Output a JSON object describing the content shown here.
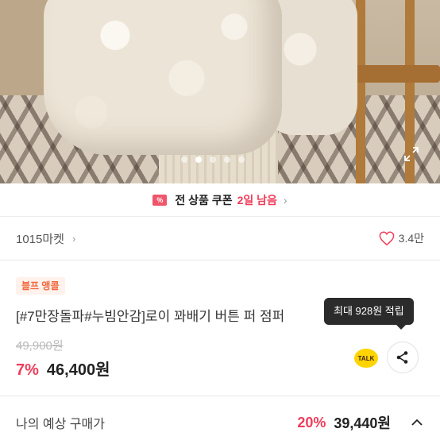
{
  "gallery": {
    "page_count": 5,
    "active_index": 1,
    "expand_icon": "expand-icon"
  },
  "coupon_banner": {
    "icon": "coupon-icon",
    "icon_text": "%",
    "text_prefix": "전 상품 쿠폰",
    "highlight": "2일 남음",
    "chevron": "›"
  },
  "seller": {
    "name": "1015마켓",
    "chevron": "›",
    "likes": "3.4만",
    "heart_color": "#ef3d5a"
  },
  "product": {
    "badge": "블프 앵콜",
    "title": "[#7만장돌파#누빔안감]로이 꽈배기 버튼 퍼 점퍼",
    "original_price": "49,900원",
    "discount": "7%",
    "price": "46,400원"
  },
  "tooltip": {
    "text": "최대 928원 적립"
  },
  "actions": {
    "talk_label": "TALK",
    "share_icon": "share-icon"
  },
  "expected_price": {
    "label": "나의 예상 구매가",
    "discount": "20%",
    "price": "39,440원"
  },
  "colors": {
    "accent": "#ef3d5a",
    "badge_bg": "#fff1ec",
    "badge_text": "#f0683b",
    "tooltip_bg": "#2b2b2b",
    "kakao_yellow": "#ffd400"
  }
}
